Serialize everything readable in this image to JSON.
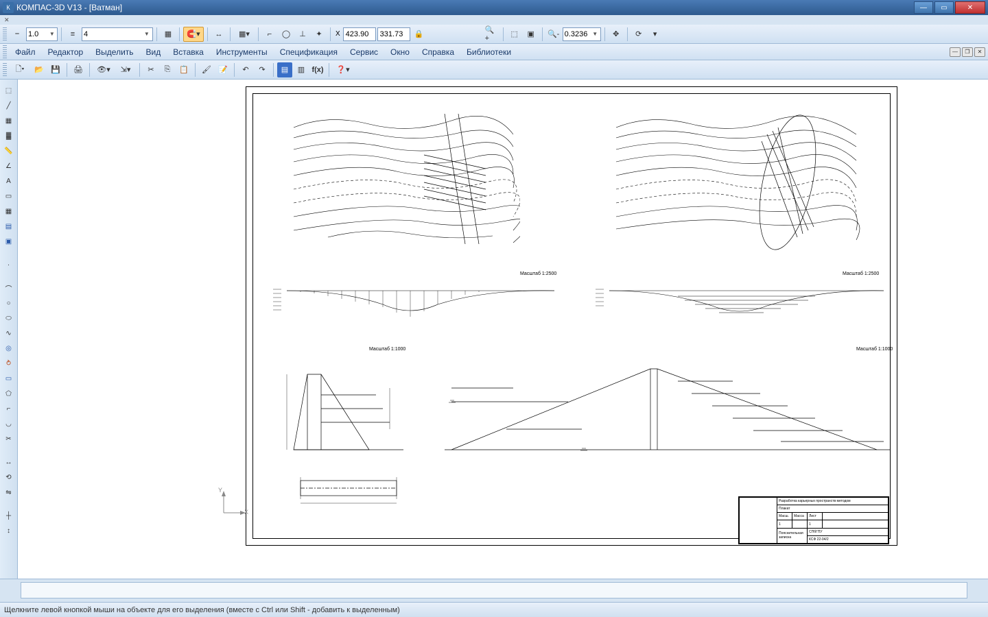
{
  "window": {
    "app_icon": "К",
    "title": "КОМПАС-3D V13 - [Ватман]",
    "min": "—",
    "max": "▭",
    "close": "✕"
  },
  "mdibar": {
    "close": "✕"
  },
  "toolbar1": {
    "lineweight": "1.0",
    "layer": "4",
    "coord_x_label": "X",
    "coord_x": "423.90",
    "coord_y": "331.73",
    "zoom": "0.3236"
  },
  "menus": {
    "file": "Файл",
    "editor": "Редактор",
    "select": "Выделить",
    "view": "Вид",
    "insert": "Вставка",
    "tools": "Инструменты",
    "spec": "Спецификация",
    "service": "Сервис",
    "window": "Окно",
    "help": "Справка",
    "libs": "Библиотеки"
  },
  "drawing": {
    "scale1": "Масштаб 1:2500",
    "scale2": "Масштаб 1:2500",
    "scale3": "Масштаб 1:1000",
    "scale4": "Масштаб 1:1000",
    "axis_y": "Y",
    "axis_x": "X"
  },
  "titleblock": {
    "r1": "Разработка карьерных пространств методом",
    "r2": "Плакат",
    "r3": "Пояснительная",
    "r4": "записка",
    "org1": "СПбГПУ",
    "org2": "КСФ 22-04/2",
    "h1": "Масш.",
    "h2": "Масса",
    "h3": "Лист",
    "v1": "1",
    "v2": "",
    "v3": "1"
  },
  "cmdbar": {
    "value": ""
  },
  "status": {
    "text": "Щелкните левой кнопкой мыши на объекте для его выделения (вместе с Ctrl или Shift - добавить к выделенным)"
  },
  "mdi": {
    "min": "—",
    "restore": "❐",
    "close": "✕"
  }
}
